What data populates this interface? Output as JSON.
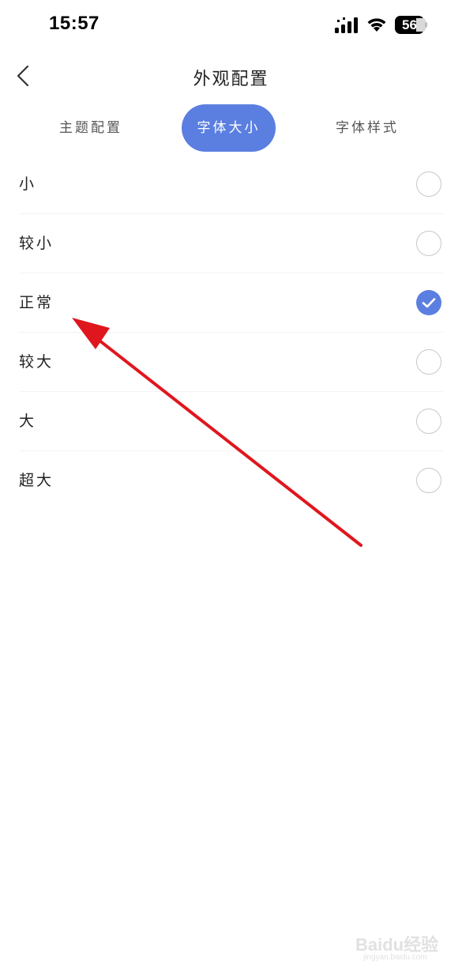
{
  "status_bar": {
    "time": "15:57",
    "battery_level": "56",
    "icons": [
      "signal-icon",
      "wifi-icon",
      "battery-icon"
    ]
  },
  "nav": {
    "title": "外观配置",
    "back_icon": "chevron-left-icon"
  },
  "tabs": [
    {
      "label": "主题配置",
      "active": false
    },
    {
      "label": "字体大小",
      "active": true
    },
    {
      "label": "字体样式",
      "active": false
    }
  ],
  "options": [
    {
      "label": "小",
      "checked": false
    },
    {
      "label": "较小",
      "checked": false
    },
    {
      "label": "正常",
      "checked": true
    },
    {
      "label": "较大",
      "checked": false
    },
    {
      "label": "大",
      "checked": false
    },
    {
      "label": "超大",
      "checked": false
    }
  ],
  "colors": {
    "accent": "#5b7fe0",
    "annotation": "#e0161e",
    "radio_border": "#c8c8c8"
  },
  "watermark": {
    "text": "Baidu经验",
    "sub": "jingyan.baidu.com"
  }
}
